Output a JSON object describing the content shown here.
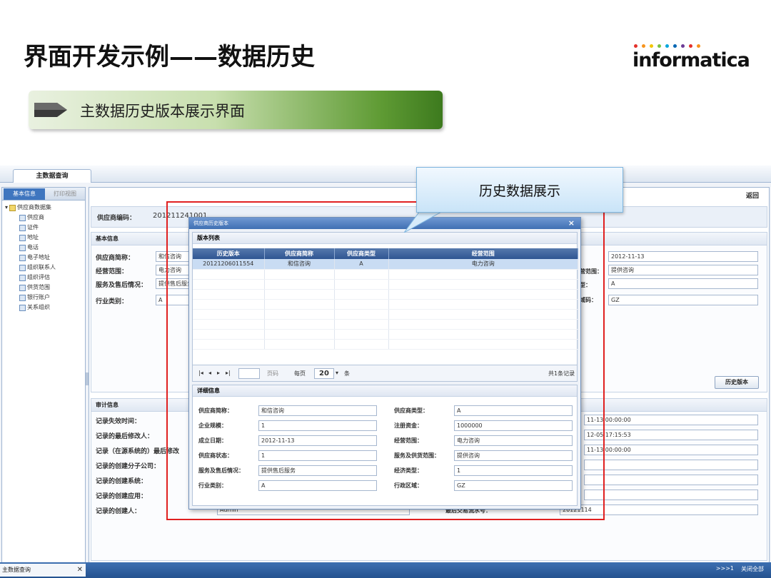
{
  "slide": {
    "title": "界面开发示例——数据历史",
    "subtitle": "主数据历史版本展示界面",
    "logo_text": "informatica",
    "logo_dot_colors": [
      "#e4312b",
      "#f7941d",
      "#f2c500",
      "#7ac143",
      "#00a6dd",
      "#0066b3",
      "#6c3b96",
      "#e4312b",
      "#f7941d"
    ]
  },
  "app": {
    "main_tab": "主数据查询",
    "left_tabs": {
      "basic": "基本信息",
      "print": "打印视图"
    },
    "tree": {
      "root": "供应商数据集",
      "children": [
        "供应商",
        "证件",
        "地址",
        "电话",
        "电子地址",
        "组织联系人",
        "组织评估",
        "供货范围",
        "银行账户",
        "关系组织"
      ]
    },
    "return_label": "返回",
    "supplier_code_label": "供应商编码：",
    "supplier_code_value": "201211241001",
    "basic_section": {
      "title": "基本信息",
      "labels": [
        "供应商简称：",
        "经营范围：",
        "服务及售后情况：",
        "行业类别："
      ],
      "values": [
        "和信咨询",
        "电力咨询",
        "提供售后服务",
        "A"
      ],
      "right_labels": [
        "",
        "营范围：",
        "型：",
        "域码："
      ],
      "right_values": [
        "2012-11-13",
        "提供咨询",
        "A",
        "GZ"
      ]
    },
    "history_button": "历史版本",
    "audit_section": {
      "title": "审计信息",
      "labels": [
        "记录失效时间：",
        "记录的最后修改人：",
        "记录（在源系统的）最后修改",
        "记录的创建分子公司：",
        "记录的创建系统：",
        "记录的创建应用：",
        "记录的创建人："
      ],
      "right_values": [
        "11-13 00:00:00",
        "12-05 17:15:53",
        "11-13 00:00:00"
      ],
      "creator": "Admin",
      "txn_label": "最后交易流水号：",
      "txn_value": "20121114"
    },
    "status_bar": {
      "tab": "主数据查询",
      "close": "✕",
      "right_items": [
        ">>>1",
        "关闭全部"
      ]
    }
  },
  "modal": {
    "title": "供应商历史版本",
    "close": "×",
    "list_title": "版本列表",
    "columns": [
      "历史版本",
      "供应商简称",
      "供应商类型",
      "经营范围"
    ],
    "rows": [
      [
        "20121206011554",
        "和信咨询",
        "A",
        "电力咨询"
      ]
    ],
    "pager": {
      "page_label": "页码",
      "per_page_label": "每页",
      "page_size": "20",
      "unit": "条",
      "total": "共1条记录"
    },
    "detail": {
      "title": "详细信息",
      "left_labels": [
        "供应商简称：",
        "企业规模：",
        "成立日期：",
        "供应商状态：",
        "服务及售后情况：",
        "行业类别："
      ],
      "left_values": [
        "和信咨询",
        "1",
        "2012-11-13",
        "1",
        "提供售后服务",
        "A"
      ],
      "right_labels": [
        "供应商类型：",
        "注册资金：",
        "经营范围：",
        "服务及供货范围：",
        "经济类型：",
        "行政区域："
      ],
      "right_values": [
        "A",
        "1000000",
        "电力咨询",
        "提供咨询",
        "1",
        "GZ"
      ]
    }
  },
  "callout": {
    "text": "历史数据展示"
  },
  "colors": {
    "highlight": "#e02020",
    "header_blue": "#2f5592",
    "selected_row": "#c9dcf3"
  }
}
